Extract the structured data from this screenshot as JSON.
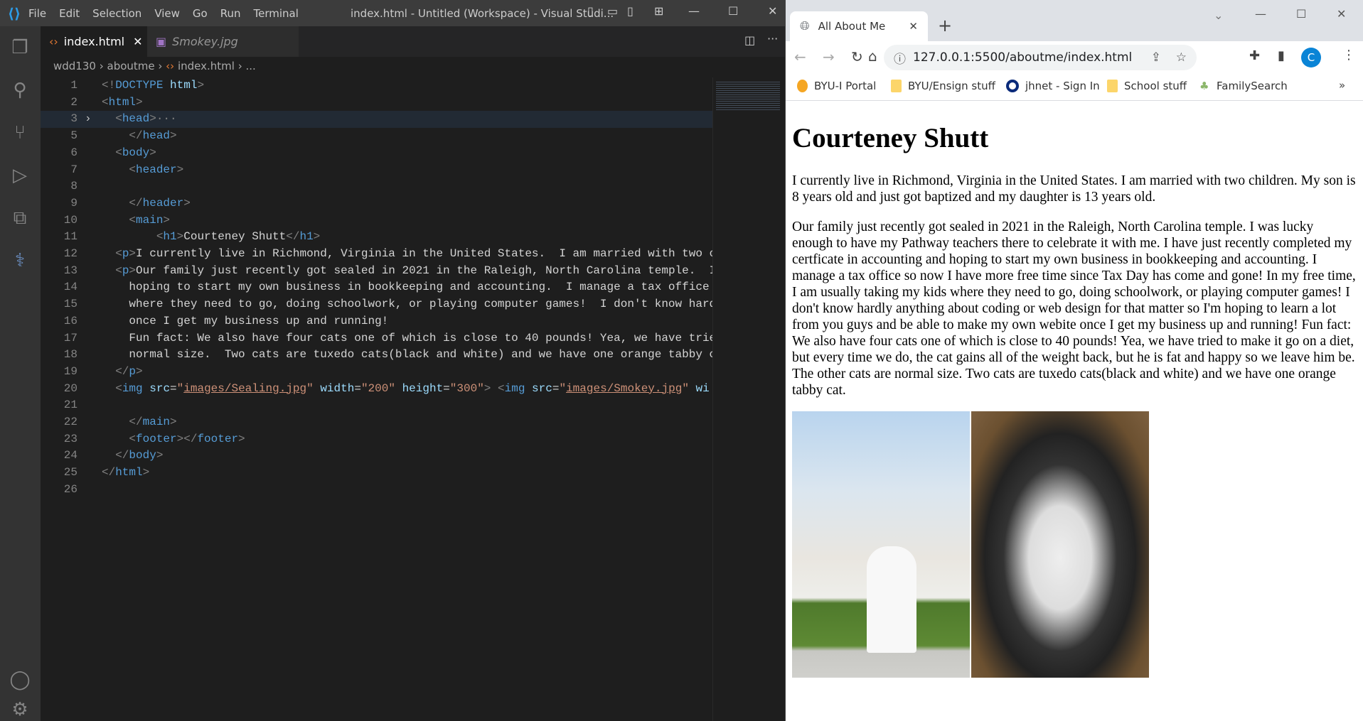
{
  "vscode": {
    "menu": [
      "File",
      "Edit",
      "Selection",
      "View",
      "Go",
      "Run",
      "Terminal"
    ],
    "window_title": "index.html - Untitled (Workspace) - Visual Studi...",
    "tabs": [
      {
        "label": "index.html",
        "active": true
      },
      {
        "label": "Smokey.jpg",
        "active": false
      }
    ],
    "breadcrumb": [
      "wdd130",
      "aboutme",
      "index.html",
      "..."
    ],
    "lines": [
      {
        "n": "1",
        "t": [
          [
            "b",
            "<!"
          ],
          [
            "t",
            "DOCTYPE"
          ],
          [
            "x",
            " "
          ],
          [
            "a",
            "html"
          ],
          [
            "b",
            ">"
          ]
        ]
      },
      {
        "n": "2",
        "t": [
          [
            "b",
            "<"
          ],
          [
            "t",
            "html"
          ],
          [
            "b",
            ">"
          ]
        ]
      },
      {
        "n": "3",
        "fold": true,
        "hl": true,
        "t": [
          [
            "x",
            "  "
          ],
          [
            "b",
            "<"
          ],
          [
            "t",
            "head"
          ],
          [
            "b",
            ">"
          ],
          [
            "e",
            "···"
          ]
        ]
      },
      {
        "n": "5",
        "t": [
          [
            "x",
            "    "
          ],
          [
            "b",
            "</"
          ],
          [
            "t",
            "head"
          ],
          [
            "b",
            ">"
          ]
        ]
      },
      {
        "n": "6",
        "t": [
          [
            "x",
            "  "
          ],
          [
            "b",
            "<"
          ],
          [
            "t",
            "body"
          ],
          [
            "b",
            ">"
          ]
        ]
      },
      {
        "n": "7",
        "t": [
          [
            "x",
            "    "
          ],
          [
            "b",
            "<"
          ],
          [
            "t",
            "header"
          ],
          [
            "b",
            ">"
          ]
        ]
      },
      {
        "n": "8",
        "t": []
      },
      {
        "n": "9",
        "t": [
          [
            "x",
            "    "
          ],
          [
            "b",
            "</"
          ],
          [
            "t",
            "header"
          ],
          [
            "b",
            ">"
          ]
        ]
      },
      {
        "n": "10",
        "t": [
          [
            "x",
            "    "
          ],
          [
            "b",
            "<"
          ],
          [
            "t",
            "main"
          ],
          [
            "b",
            ">"
          ]
        ]
      },
      {
        "n": "11",
        "t": [
          [
            "x",
            "        "
          ],
          [
            "b",
            "<"
          ],
          [
            "t",
            "h1"
          ],
          [
            "b",
            ">"
          ],
          [
            "x",
            "Courteney Shutt"
          ],
          [
            "b",
            "</"
          ],
          [
            "t",
            "h1"
          ],
          [
            "b",
            ">"
          ]
        ]
      },
      {
        "n": "12",
        "t": [
          [
            "x",
            "  "
          ],
          [
            "b",
            "<"
          ],
          [
            "t",
            "p"
          ],
          [
            "b",
            ">"
          ],
          [
            "x",
            "I currently live in Richmond, Virginia in the United States.  I am married with two c"
          ]
        ]
      },
      {
        "n": "13",
        "t": [
          [
            "x",
            "  "
          ],
          [
            "b",
            "<"
          ],
          [
            "t",
            "p"
          ],
          [
            "b",
            ">"
          ],
          [
            "x",
            "Our family just recently got sealed in 2021 in the Raleigh, North Carolina temple.  I"
          ]
        ]
      },
      {
        "n": "14",
        "t": [
          [
            "x",
            "    hoping to start my own business in bookkeeping and accounting.  I manage a tax office"
          ]
        ]
      },
      {
        "n": "15",
        "t": [
          [
            "x",
            "    where they need to go, doing schoolwork, or playing computer games!  I don't know hard"
          ]
        ]
      },
      {
        "n": "16",
        "t": [
          [
            "x",
            "    once I get my business up and running!"
          ]
        ]
      },
      {
        "n": "17",
        "t": [
          [
            "x",
            "    Fun fact: We also have four cats one of which is close to 40 pounds! Yea, we have trie"
          ]
        ]
      },
      {
        "n": "18",
        "t": [
          [
            "x",
            "    normal size.  Two cats are tuxedo cats(black and white) and we have one orange tabby c"
          ]
        ]
      },
      {
        "n": "19",
        "t": [
          [
            "x",
            "  "
          ],
          [
            "b",
            "</"
          ],
          [
            "t",
            "p"
          ],
          [
            "b",
            ">"
          ]
        ]
      },
      {
        "n": "20",
        "t": [
          [
            "x",
            "  "
          ],
          [
            "b",
            "<"
          ],
          [
            "t",
            "img"
          ],
          [
            "x",
            " "
          ],
          [
            "a",
            "src"
          ],
          [
            "x",
            "="
          ],
          [
            "q",
            "\""
          ],
          [
            "s",
            "images/Sealing.jpg"
          ],
          [
            "q",
            "\""
          ],
          [
            "x",
            " "
          ],
          [
            "a",
            "width"
          ],
          [
            "x",
            "="
          ],
          [
            "q",
            "\"200\""
          ],
          [
            "x",
            " "
          ],
          [
            "a",
            "height"
          ],
          [
            "x",
            "="
          ],
          [
            "q",
            "\"300\""
          ],
          [
            "b",
            ">"
          ],
          [
            "x",
            " "
          ],
          [
            "b",
            "<"
          ],
          [
            "t",
            "img"
          ],
          [
            "x",
            " "
          ],
          [
            "a",
            "src"
          ],
          [
            "x",
            "="
          ],
          [
            "q",
            "\""
          ],
          [
            "s",
            "images/Smokey.jpg"
          ],
          [
            "q",
            "\""
          ],
          [
            "x",
            " "
          ],
          [
            "a",
            "wi"
          ]
        ]
      },
      {
        "n": "21",
        "t": []
      },
      {
        "n": "22",
        "t": [
          [
            "x",
            "    "
          ],
          [
            "b",
            "</"
          ],
          [
            "t",
            "main"
          ],
          [
            "b",
            ">"
          ]
        ]
      },
      {
        "n": "23",
        "t": [
          [
            "x",
            "    "
          ],
          [
            "b",
            "<"
          ],
          [
            "t",
            "footer"
          ],
          [
            "b",
            "></"
          ],
          [
            "t",
            "footer"
          ],
          [
            "b",
            ">"
          ]
        ]
      },
      {
        "n": "24",
        "t": [
          [
            "x",
            "  "
          ],
          [
            "b",
            "</"
          ],
          [
            "t",
            "body"
          ],
          [
            "b",
            ">"
          ]
        ]
      },
      {
        "n": "25",
        "t": [
          [
            "b",
            "</"
          ],
          [
            "t",
            "html"
          ],
          [
            "b",
            ">"
          ]
        ]
      },
      {
        "n": "26",
        "t": []
      }
    ]
  },
  "browser": {
    "tab_title": "All About Me",
    "url": "127.0.0.1:5500/aboutme/index.html",
    "profile_initial": "C",
    "bookmarks": [
      "BYU-I Portal",
      "BYU/Ensign stuff",
      "jhnet - Sign In",
      "School stuff",
      "FamilySearch"
    ],
    "more_bookmarks": "»",
    "page": {
      "heading": "Courteney Shutt",
      "paragraphs": [
        "I currently live in Richmond, Virginia in the United States. I am married with two children. My son is 8 years old and just got baptized and my daughter is 13 years old.",
        "Our family just recently got sealed in 2021 in the Raleigh, North Carolina temple. I was lucky enough to have my Pathway teachers there to celebrate it with me. I have just recently completed my certficate in accounting and hoping to start my own business in bookkeeping and accounting. I manage a tax office so now I have more free time since Tax Day has come and gone! In my free time, I am usually taking my kids where they need to go, doing schoolwork, or playing computer games! I don't know hardly anything about coding or web design for that matter so I'm hoping to learn a lot from you guys and be able to make my own webite once I get my business up and running! Fun fact: We also have four cats one of which is close to 40 pounds! Yea, we have tried to make it go on a diet, but every time we do, the cat gains all of the weight back, but he is fat and happy so we leave him be. The other cats are normal size. Two cats are tuxedo cats(black and white) and we have one orange tabby cat."
      ]
    }
  },
  "colors": {
    "vscode_accent": "#2c9ce8",
    "profile": "#1a73e8",
    "tag": "#569cd6",
    "attr": "#9cdcfe",
    "string": "#ce9178"
  }
}
